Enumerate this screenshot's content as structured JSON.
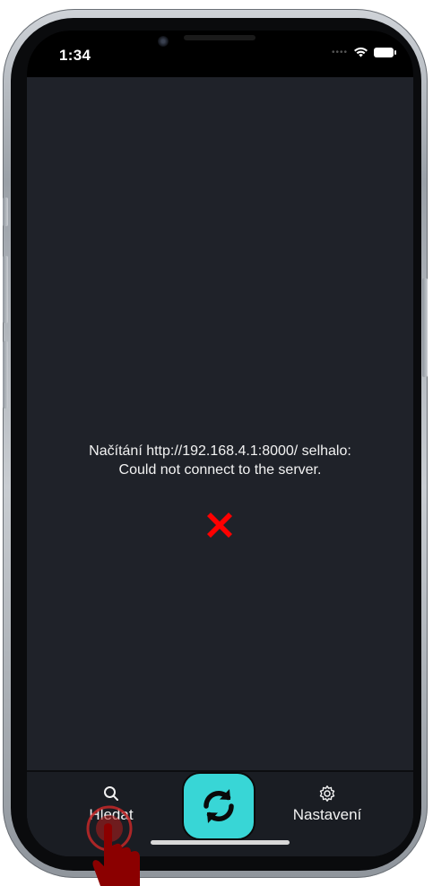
{
  "status_bar": {
    "time": "1:34",
    "icons": [
      "cellular-dots-icon",
      "wifi-icon",
      "battery-icon"
    ]
  },
  "error": {
    "message_line1": "Načítání http://192.168.4.1:8000/ selhalo:",
    "message_line2": "Could not connect to the server.",
    "icon": "x-mark-icon",
    "icon_color": "#ff0000"
  },
  "tabbar": {
    "search_label": "Hledat",
    "settings_label": "Nastavení",
    "center_icon": "refresh-icon",
    "center_color": "#38d6d6"
  },
  "colors": {
    "screen_bg": "#1f2229",
    "tabbar_bg": "#1a1d23",
    "text": "#f2f2f2"
  }
}
